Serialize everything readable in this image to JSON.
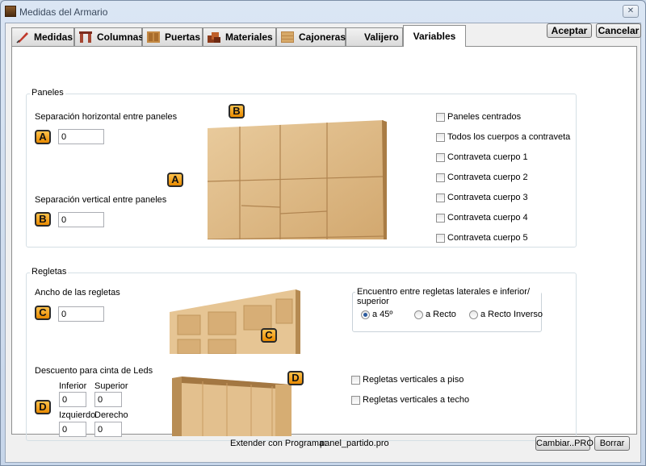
{
  "window": {
    "title": "Medidas del Armario",
    "close_label": "✕"
  },
  "tabs": [
    {
      "label": "Medidas",
      "icon": "ruler-pencil-icon"
    },
    {
      "label": "Columnas",
      "icon": "columns-icon"
    },
    {
      "label": "Puertas",
      "icon": "door-icon"
    },
    {
      "label": "Materiales",
      "icon": "materials-icon"
    },
    {
      "label": "Cajoneras",
      "icon": "drawers-icon"
    },
    {
      "label": "Valijero",
      "icon": ""
    },
    {
      "label": "Variables",
      "icon": ""
    }
  ],
  "actions": {
    "accept": "Aceptar",
    "cancel": "Cancelar"
  },
  "paneles": {
    "title": "Paneles",
    "horizontal_label": "Separación horizontal entre paneles",
    "horizontal_badge": "A",
    "horizontal_value": "0",
    "vertical_label": "Separación vertical entre paneles",
    "vertical_badge": "B",
    "vertical_value": "0",
    "image_badge_top": "B",
    "image_badge_left": "A",
    "checks": [
      "Paneles centrados",
      "Todos los cuerpos a contraveta",
      "Contraveta cuerpo 1",
      "Contraveta cuerpo 2",
      "Contraveta cuerpo 3",
      "Contraveta cuerpo 4",
      "Contraveta cuerpo 5"
    ]
  },
  "regletas": {
    "title": "Regletas",
    "ancho_label": "Ancho de las regletas",
    "ancho_badge": "C",
    "ancho_value": "0",
    "image_badge_c": "C",
    "image_badge_d": "D",
    "descuento_label": "Descuento para cinta de Leds",
    "descuento_badge": "D",
    "inferior_label": "Inferior",
    "inferior_value": "0",
    "superior_label": "Superior",
    "superior_value": "0",
    "izquierdo_label": "Izquierdo",
    "izquierdo_value": "0",
    "derecho_label": "Derecho",
    "derecho_value": "0",
    "encuentro_title": "Encuentro entre regletas laterales e inferior/ superior",
    "radios": [
      "a 45º",
      "a Recto",
      "a Recto Inverso"
    ],
    "radio_selected": 0,
    "checks": [
      "Regletas verticales a piso",
      "Regletas verticales a techo"
    ]
  },
  "footer": {
    "extender_label": "Extender con Programa:",
    "program_value": "panel_partido.pro",
    "cambiar_label": "Cambiar..PRO",
    "borrar_label": "Borrar"
  },
  "colors": {
    "wood_light": "#e8c79a",
    "wood_dark": "#cfa56d",
    "badge": "#f0a020"
  }
}
